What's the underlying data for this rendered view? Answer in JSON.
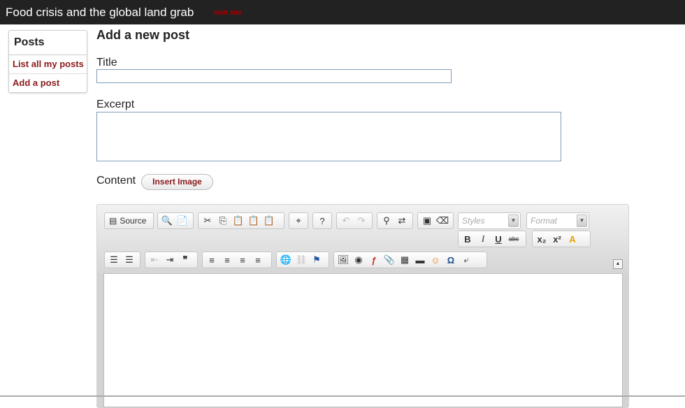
{
  "header": {
    "site_title": "Food crisis and the global land grab",
    "visit_link": "visit site"
  },
  "sidebar": {
    "heading": "Posts",
    "items": [
      {
        "label": "List all my posts"
      },
      {
        "label": "Add a post"
      }
    ]
  },
  "form": {
    "title": "Add a new post",
    "title_label": "Title",
    "title_value": "",
    "excerpt_label": "Excerpt",
    "excerpt_value": "",
    "content_label": "Content",
    "insert_image_label": "Insert Image"
  },
  "editor": {
    "source_label": "Source",
    "styles_placeholder": "Styles",
    "format_placeholder": "Format",
    "icons": {
      "preview": "🔍",
      "templates": "📄",
      "cut": "✂",
      "copy": "⎘",
      "paste": "📋",
      "paste_text": "📋",
      "paste_word": "📋",
      "spellcheck": "⌖",
      "help": "?",
      "undo": "↶",
      "redo": "↷",
      "find": "⚲",
      "replace": "⇄",
      "select_all": "▣",
      "remove_format": "⌫",
      "bold": "B",
      "italic": "I",
      "underline": "U",
      "strike": "abc",
      "subscript": "x₂",
      "superscript": "x²",
      "text_color": "A",
      "numbered_list": "☰",
      "bulleted_list": "☰",
      "outdent": "⇤",
      "indent": "⇥",
      "blockquote": "❞",
      "align_left": "≡",
      "align_center": "≡",
      "align_right": "≡",
      "justify": "≡",
      "link": "🌐",
      "unlink": "⛓",
      "anchor": "⚑",
      "image": "🖼",
      "flash_embed": "◉",
      "flash": "ƒ",
      "attachment": "📎",
      "table": "▦",
      "hr": "▬",
      "smiley": "☺",
      "special_char": "Ω",
      "page_break": "⤶",
      "collapse": "▲"
    }
  }
}
